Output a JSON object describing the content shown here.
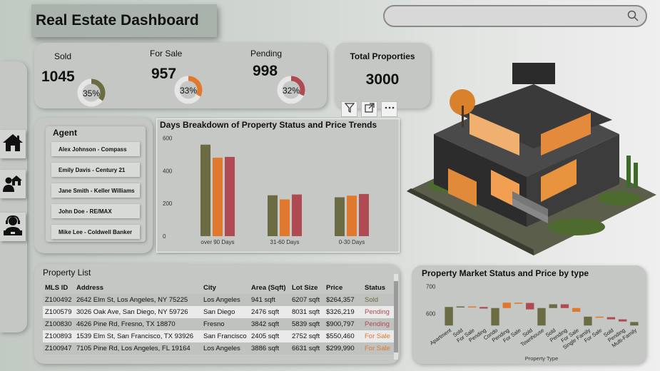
{
  "header": {
    "title": "Real Estate Dashboard"
  },
  "search": {
    "placeholder": ""
  },
  "kpis": [
    {
      "label": "Sold",
      "value": "1045",
      "pct": "35%",
      "fraction": 0.35,
      "color": "#6b6b44"
    },
    {
      "label": "For Sale",
      "value": "957",
      "pct": "33%",
      "fraction": 0.33,
      "color": "#e0782e"
    },
    {
      "label": "Pending",
      "value": "998",
      "pct": "32%",
      "fraction": 0.32,
      "color": "#b04a52"
    }
  ],
  "total": {
    "label": "Total Proporties",
    "value": "3000"
  },
  "nav": {
    "items": [
      "home-icon",
      "agent-house-icon",
      "support-agent-icon"
    ]
  },
  "agents": {
    "title": "Agent",
    "items": [
      "Alex Johnson - Compass",
      "Emily Davis - Century 21",
      "Jane Smith - Keller Williams",
      "John Doe - RE/MAX",
      "Mike Lee - Coldwell Banker"
    ]
  },
  "toolbar": {
    "icons": [
      "filter-icon",
      "focus-mode-icon",
      "more-options-icon"
    ]
  },
  "chart_data": [
    {
      "type": "bar",
      "title": "Days Breakdown of Property Status and Price Trends",
      "categories": [
        "over 90 Days",
        "31-60 Days",
        "0-30 Days"
      ],
      "series": [
        {
          "values": [
            560,
            250,
            238
          ],
          "color": "#6b6b44"
        },
        {
          "values": [
            480,
            225,
            248
          ],
          "color": "#e0782e"
        },
        {
          "values": [
            485,
            255,
            258
          ],
          "color": "#b04a52"
        }
      ],
      "yticks": [
        "0",
        "200",
        "400",
        "600"
      ],
      "ylim": [
        0,
        620
      ]
    },
    {
      "type": "bar",
      "title": "Property Market Status and Price by type",
      "xlabel": "Property Type",
      "yticks": [
        "600",
        "700"
      ],
      "ylim": [
        545,
        715
      ],
      "categories": [
        "Apartment",
        "Sold",
        "For Sale",
        "Pending",
        "Condo",
        "Pending",
        "For Sale",
        "Sold",
        "Townhouse",
        "Sold",
        "Pending",
        "For Sale",
        "Single Family",
        "For Sale",
        "Sold",
        "Pending",
        "Multi-Family"
      ],
      "values": [
        {
          "start": 555,
          "end": 624,
          "color": "#6b6b44"
        },
        {
          "start": 624,
          "end": 626,
          "color": "#6b6b44"
        },
        {
          "start": 626,
          "end": 624,
          "color": "#e0782e"
        },
        {
          "start": 624,
          "end": 618,
          "color": "#b04a52"
        },
        {
          "start": 555,
          "end": 620,
          "color": "#6b6b44"
        },
        {
          "start": 620,
          "end": 640,
          "color": "#e0782e"
        },
        {
          "start": 640,
          "end": 639,
          "color": "#e0782e"
        },
        {
          "start": 639,
          "end": 615,
          "color": "#b04a52"
        },
        {
          "start": 555,
          "end": 620,
          "color": "#6b6b44"
        },
        {
          "start": 620,
          "end": 634,
          "color": "#6b6b44"
        },
        {
          "start": 634,
          "end": 620,
          "color": "#b04a52"
        },
        {
          "start": 620,
          "end": 606,
          "color": "#e0782e"
        },
        {
          "start": 555,
          "end": 588,
          "color": "#6b6b44"
        },
        {
          "start": 588,
          "end": 586,
          "color": "#e0782e"
        },
        {
          "start": 586,
          "end": 578,
          "color": "#b04a52"
        },
        {
          "start": 578,
          "end": 570,
          "color": "#b04a52"
        },
        {
          "start": 555,
          "end": 568,
          "color": "#6b6b44"
        }
      ]
    }
  ],
  "property_list": {
    "title": "Property List",
    "columns": [
      "MLS ID",
      "Address",
      "City",
      "Area (Sqft)",
      "Lot Size",
      "Price",
      "Status"
    ],
    "rows": [
      [
        "Z100492",
        "2642 Elm St, Los Angeles, NY 75225",
        "Los Angeles",
        "941 sqft",
        "6207 sqft",
        "$264,357",
        "Sold"
      ],
      [
        "Z100579",
        "3026 Oak Ave, San Diego, NY 59726",
        "San Diego",
        "2476 sqft",
        "8031 sqft",
        "$326,219",
        "Pending"
      ],
      [
        "Z100830",
        "4626 Pine Rd, Fresno, TX 18870",
        "Fresno",
        "3842 sqft",
        "5839 sqft",
        "$900,797",
        "Pending"
      ],
      [
        "Z100893",
        "1539 Elm St, San Francisco, TX 93926",
        "San Francisco",
        "2405 sqft",
        "2752 sqft",
        "$550,460",
        "For Sale"
      ],
      [
        "Z100947",
        "7105 Pine Rd, Los Angeles, FL 19164",
        "Los Angeles",
        "3886 sqft",
        "6631 sqft",
        "$299,990",
        "For Sale"
      ]
    ],
    "status_colors": {
      "Sold": "#6b6b44",
      "Pending": "#b04a52",
      "For Sale": "#e0782e"
    }
  }
}
